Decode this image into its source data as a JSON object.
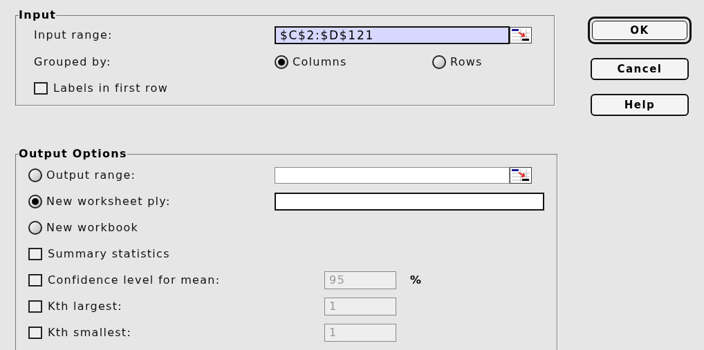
{
  "input": {
    "title": "Input",
    "input_range": {
      "label": "Input range:",
      "value": "$C$2:$D$121",
      "text_selected": true
    },
    "grouped_by": {
      "label": "Grouped by:",
      "options": [
        {
          "label": "Columns",
          "selected": true
        },
        {
          "label": "Rows",
          "selected": false
        }
      ]
    },
    "labels_in_first_row": {
      "label": "Labels in first row",
      "checked": false
    }
  },
  "output_options": {
    "title": "Output Options",
    "destinations": [
      {
        "label": "Output range:",
        "selected": false,
        "kind": "range"
      },
      {
        "label": "New worksheet ply:",
        "selected": true,
        "kind": "text"
      },
      {
        "label": "New workbook",
        "selected": false,
        "kind": "none"
      }
    ],
    "options": [
      {
        "label": "Summary statistics",
        "checked": false
      },
      {
        "label": "Confidence level for mean:",
        "checked": false,
        "value": "95",
        "disabled": true,
        "unit": "%"
      },
      {
        "label": "Kth largest:",
        "checked": false,
        "value": "1",
        "disabled": true
      },
      {
        "label": "Kth smallest:",
        "checked": false,
        "value": "1",
        "disabled": true
      }
    ]
  },
  "buttons": [
    {
      "label": "OK",
      "default": true
    },
    {
      "label": "Cancel",
      "default": false
    },
    {
      "label": "Help",
      "default": false
    }
  ]
}
